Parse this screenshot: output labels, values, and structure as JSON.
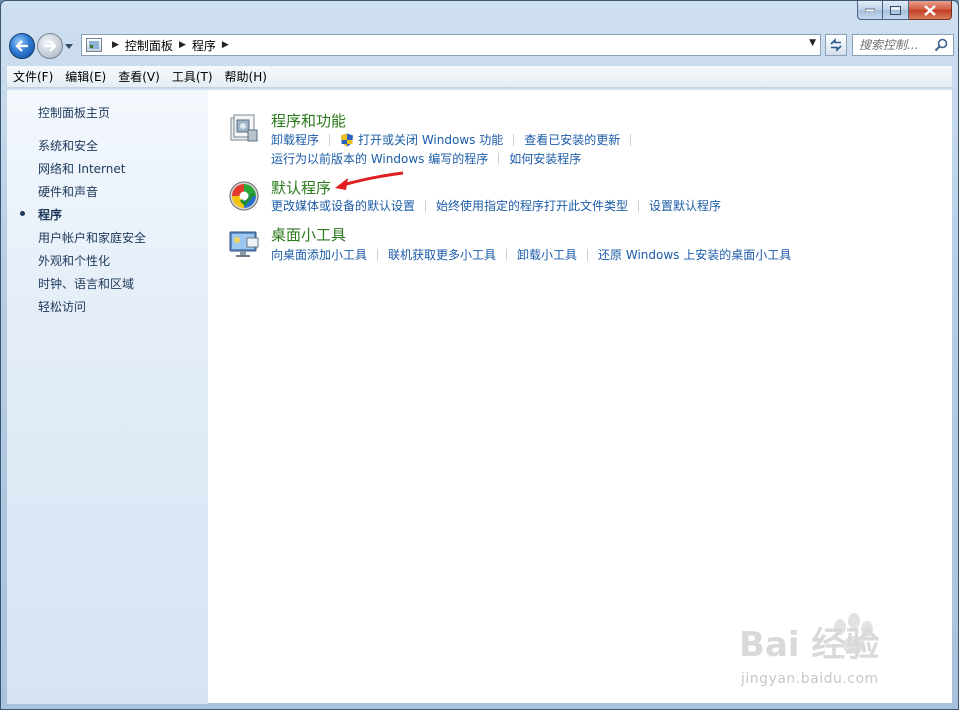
{
  "window": {
    "caption": {
      "minimize": "—",
      "maximize": "□",
      "close": "✕"
    }
  },
  "navbar": {
    "breadcrumb": [
      "控制面板",
      "程序"
    ],
    "search_placeholder": "搜索控制..."
  },
  "menubar": {
    "items": [
      "文件(F)",
      "编辑(E)",
      "查看(V)",
      "工具(T)",
      "帮助(H)"
    ]
  },
  "sidebar": {
    "home": "控制面板主页",
    "items": [
      "系统和安全",
      "网络和 Internet",
      "硬件和声音",
      "程序",
      "用户帐户和家庭安全",
      "外观和个性化",
      "时钟、语言和区域",
      "轻松访问"
    ],
    "current_index": 3
  },
  "categories": [
    {
      "title": "程序和功能",
      "icon": "programs-features-icon",
      "rows": [
        [
          "卸载程序",
          "打开或关闭 Windows 功能",
          "查看已安装的更新"
        ],
        [
          "运行为以前版本的 Windows 编写的程序",
          "如何安装程序"
        ]
      ]
    },
    {
      "title": "默认程序",
      "icon": "default-programs-icon",
      "rows": [
        [
          "更改媒体或设备的默认设置",
          "始终使用指定的程序打开此文件类型",
          "设置默认程序"
        ]
      ]
    },
    {
      "title": "桌面小工具",
      "icon": "desktop-gadgets-icon",
      "rows": [
        [
          "向桌面添加小工具",
          "联机获取更多小工具",
          "卸载小工具",
          "还原 Windows 上安装的桌面小工具"
        ]
      ]
    }
  ],
  "watermark": {
    "logo": "Bai 经验",
    "url": "jingyan.baidu.com"
  },
  "colors": {
    "category_title": "#2a7a1c",
    "task_link": "#1c5ca8",
    "sidebar_text": "#1e395b",
    "annotation_arrow": "#e02020"
  }
}
